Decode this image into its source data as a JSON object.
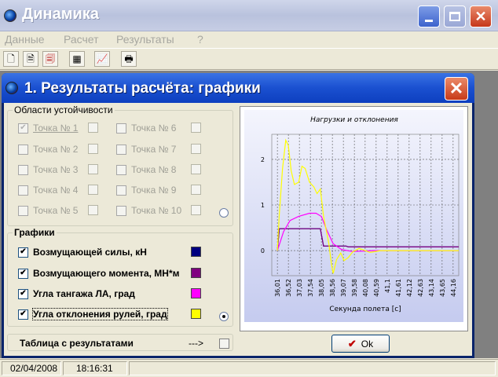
{
  "window": {
    "title": "Динамика"
  },
  "menu": [
    "Данные",
    "Расчет",
    "Результаты",
    "?"
  ],
  "toolbar": [
    {
      "icon": "new-file-icon",
      "glyph": "🗋"
    },
    {
      "icon": "document-icon",
      "glyph": "🗎"
    },
    {
      "icon": "load-data-icon",
      "glyph": "🗐"
    },
    {
      "icon": "calculator-icon",
      "glyph": "▦"
    },
    {
      "icon": "chart-icon",
      "glyph": "📈"
    },
    {
      "icon": "print-icon",
      "glyph": "🖶"
    }
  ],
  "child": {
    "title": "1. Результаты расчёта: графики",
    "close_glyph": "✕"
  },
  "stability": {
    "caption": "Области устойчивости",
    "points": [
      {
        "label": "Точка № 1",
        "checked": true
      },
      {
        "label": "Точка № 2",
        "checked": false
      },
      {
        "label": "Точка № 3",
        "checked": false
      },
      {
        "label": "Точка № 4",
        "checked": false
      },
      {
        "label": "Точка № 5",
        "checked": false
      },
      {
        "label": "Точка № 6",
        "checked": false
      },
      {
        "label": "Точка № 7",
        "checked": false
      },
      {
        "label": "Точка № 8",
        "checked": false
      },
      {
        "label": "Точка № 9",
        "checked": false
      },
      {
        "label": "Точка № 10",
        "checked": false
      }
    ]
  },
  "graphs": {
    "caption": "Графики",
    "items": [
      {
        "label": "Возмущающей силы, кН",
        "checked": true,
        "color": "#000080"
      },
      {
        "label": "Возмущающего момента, МН*м",
        "checked": true,
        "color": "#800080"
      },
      {
        "label": "Угла тангажа ЛА, град",
        "checked": true,
        "color": "#ff00ff"
      },
      {
        "label": "Угла отклонения рулей, град",
        "checked": true,
        "color": "#ffff00"
      }
    ]
  },
  "table_button": {
    "label": "Таблица с результатами",
    "arrow": "--->"
  },
  "ok_button": {
    "label": "Ok",
    "check": "✔"
  },
  "chart_data": {
    "type": "line",
    "title": "Нагрузки и отклонения",
    "xlabel": "Секунда полета [c]",
    "ylabel": "",
    "x_ticks": [
      "36,01",
      "36,52",
      "37,03",
      "37,54",
      "38,05",
      "38,56",
      "39,07",
      "39,58",
      "40,08",
      "40,59",
      "41,1",
      "41,61",
      "42,12",
      "42,63",
      "43,14",
      "43,65",
      "44,16"
    ],
    "y_ticks": [
      "0",
      "1",
      "2"
    ],
    "xlim": [
      35.75,
      44.42
    ],
    "ylim": [
      -0.55,
      2.55
    ],
    "grid": true,
    "series": [
      {
        "color": "#000080",
        "x": [
          36.01,
          36.1,
          38.0,
          38.15,
          39.2,
          39.3,
          44.42
        ],
        "y": [
          0,
          0.48,
          0.48,
          0.1,
          0.1,
          0.08,
          0.08
        ]
      },
      {
        "color": "#800080",
        "x": [
          36.01,
          36.1,
          38.0,
          38.15,
          39.2,
          39.3,
          44.42
        ],
        "y": [
          0,
          0.48,
          0.48,
          0.1,
          0.1,
          0.08,
          0.08
        ]
      },
      {
        "color": "#ff00ff",
        "x": [
          36.01,
          36.3,
          36.6,
          37.0,
          37.5,
          37.8,
          38.05,
          38.3,
          38.6,
          39.0,
          39.5,
          40.5,
          44.42
        ],
        "y": [
          0,
          0.42,
          0.66,
          0.75,
          0.82,
          0.82,
          0.75,
          0.45,
          0.15,
          0.02,
          -0.02,
          0,
          0
        ]
      },
      {
        "color": "#ffff00",
        "x": [
          36.01,
          36.1,
          36.25,
          36.4,
          36.52,
          36.65,
          36.8,
          37.0,
          37.15,
          37.3,
          37.5,
          37.7,
          37.85,
          38.0,
          38.15,
          38.4,
          38.52,
          38.6,
          38.75,
          38.95,
          39.1,
          39.3,
          39.5,
          39.8,
          40.3,
          40.8,
          44.42
        ],
        "y": [
          0,
          0.8,
          1.8,
          2.42,
          2.3,
          1.75,
          1.45,
          1.5,
          1.85,
          1.8,
          1.5,
          1.4,
          1.25,
          1.35,
          0.75,
          0.15,
          -0.3,
          -0.5,
          -0.2,
          -0.05,
          -0.22,
          -0.15,
          -0.03,
          0.05,
          -0.04,
          0,
          0
        ]
      }
    ]
  },
  "status": {
    "date": "02/04/2008",
    "time": "18:16:31"
  }
}
